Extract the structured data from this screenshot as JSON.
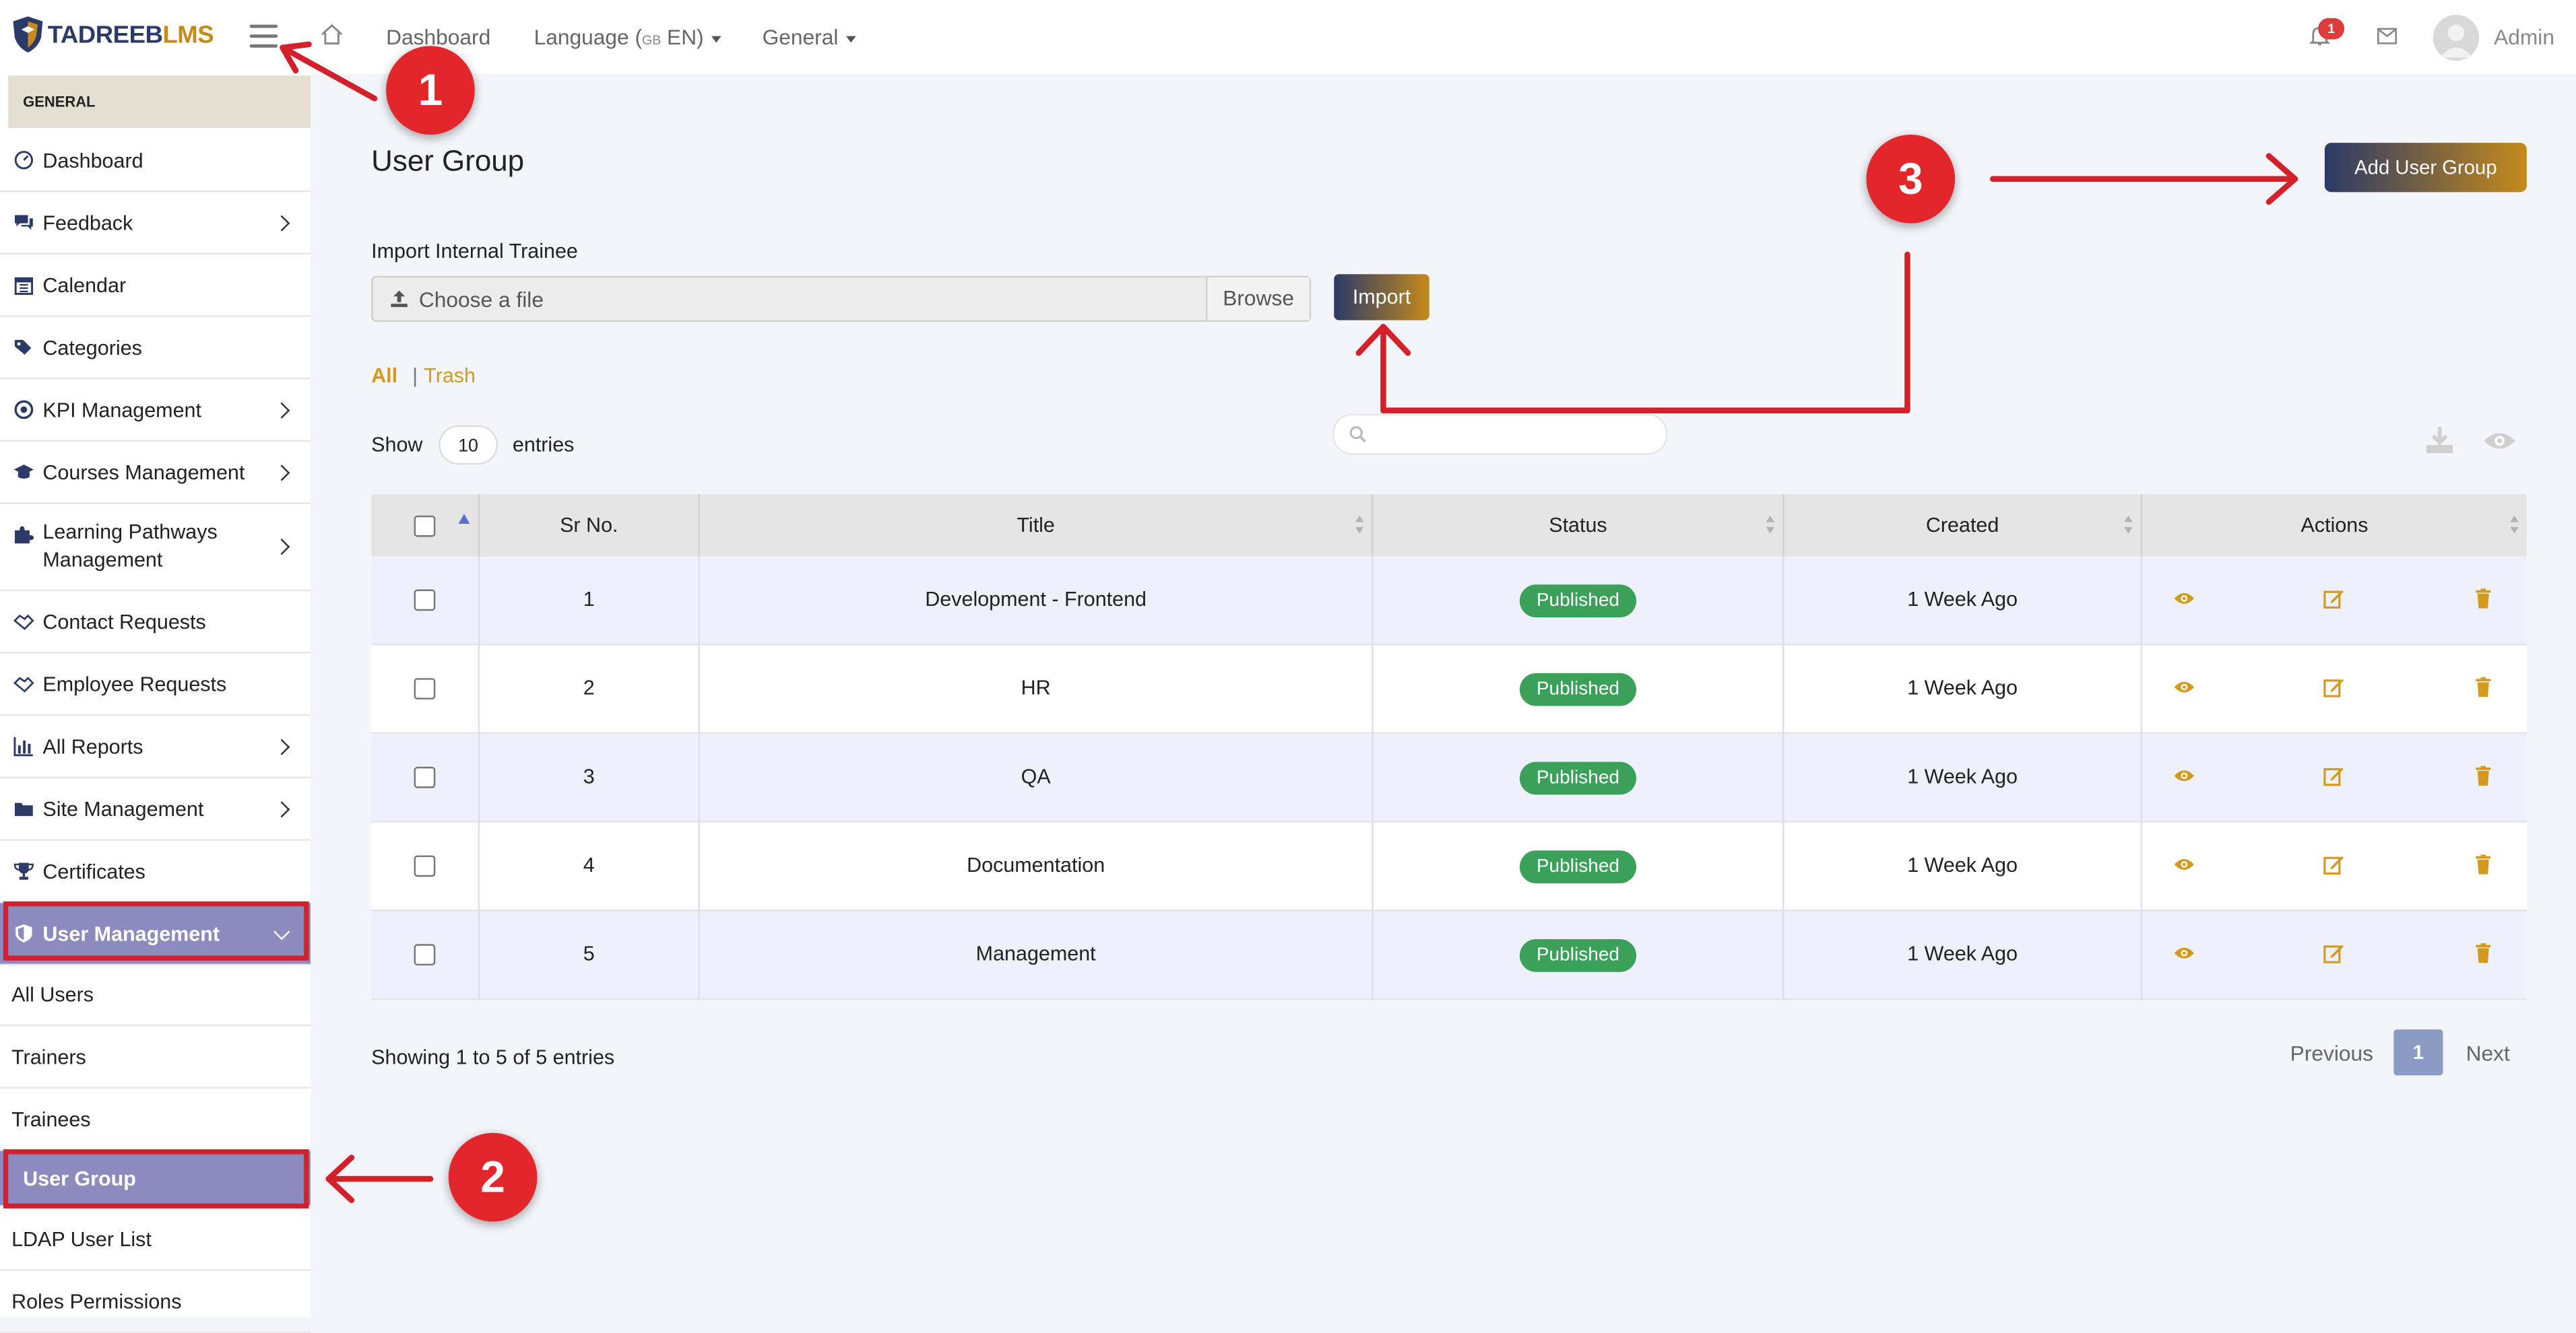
{
  "header": {
    "logo": {
      "part1": "TADREEB",
      "part2": "LMS"
    },
    "nav": {
      "dashboard": "Dashboard",
      "language": "Language (",
      "language_flag": "GB",
      "language_code": " EN)",
      "general": "General"
    },
    "notifications_count": "1",
    "user_name": "Admin"
  },
  "sidebar": {
    "section": "GENERAL",
    "items": [
      {
        "label": "Dashboard"
      },
      {
        "label": "Feedback"
      },
      {
        "label": "Calendar"
      },
      {
        "label": "Categories"
      },
      {
        "label": "KPI Management"
      },
      {
        "label": "Courses Management"
      },
      {
        "label": "Learning Pathways Management"
      },
      {
        "label": "Contact Requests"
      },
      {
        "label": "Employee Requests"
      },
      {
        "label": "All Reports"
      },
      {
        "label": "Site Management"
      },
      {
        "label": "Certificates"
      },
      {
        "label": "User Management"
      }
    ],
    "sub_items": [
      {
        "label": "All Users"
      },
      {
        "label": "Trainers"
      },
      {
        "label": "Trainees"
      },
      {
        "label": "User Group"
      },
      {
        "label": "LDAP User List"
      },
      {
        "label": "Roles Permissions"
      }
    ]
  },
  "main": {
    "title": "User Group",
    "add_button": "Add User Group",
    "import_label": "Import Internal Trainee",
    "file_placeholder": "Choose a file",
    "browse": "Browse",
    "import_button": "Import",
    "filters": {
      "all": "All",
      "separator": "|",
      "trash": "Trash"
    },
    "show": "Show",
    "page_length": "10",
    "entries": "entries",
    "table": {
      "headers": [
        "Sr No.",
        "Title",
        "Status",
        "Created",
        "Actions"
      ],
      "rows": [
        {
          "sr": "1",
          "title": "Development - Frontend",
          "status": "Published",
          "created": "1 Week Ago"
        },
        {
          "sr": "2",
          "title": "HR",
          "status": "Published",
          "created": "1 Week Ago"
        },
        {
          "sr": "3",
          "title": "QA",
          "status": "Published",
          "created": "1 Week Ago"
        },
        {
          "sr": "4",
          "title": "Documentation",
          "status": "Published",
          "created": "1 Week Ago"
        },
        {
          "sr": "5",
          "title": "Management",
          "status": "Published",
          "created": "1 Week Ago"
        }
      ]
    },
    "info": "Showing 1 to 5 of 5 entries",
    "pagination": {
      "previous": "Previous",
      "current": "1",
      "next": "Next"
    }
  },
  "annotations": {
    "callouts": [
      "1",
      "2",
      "3"
    ]
  },
  "colors": {
    "accent_gold": "#d49a1e",
    "brand_navy": "#2b3a67",
    "active_purple": "#8b8bbf",
    "status_green": "#3aa05a",
    "annotation_red": "#e3262b"
  }
}
